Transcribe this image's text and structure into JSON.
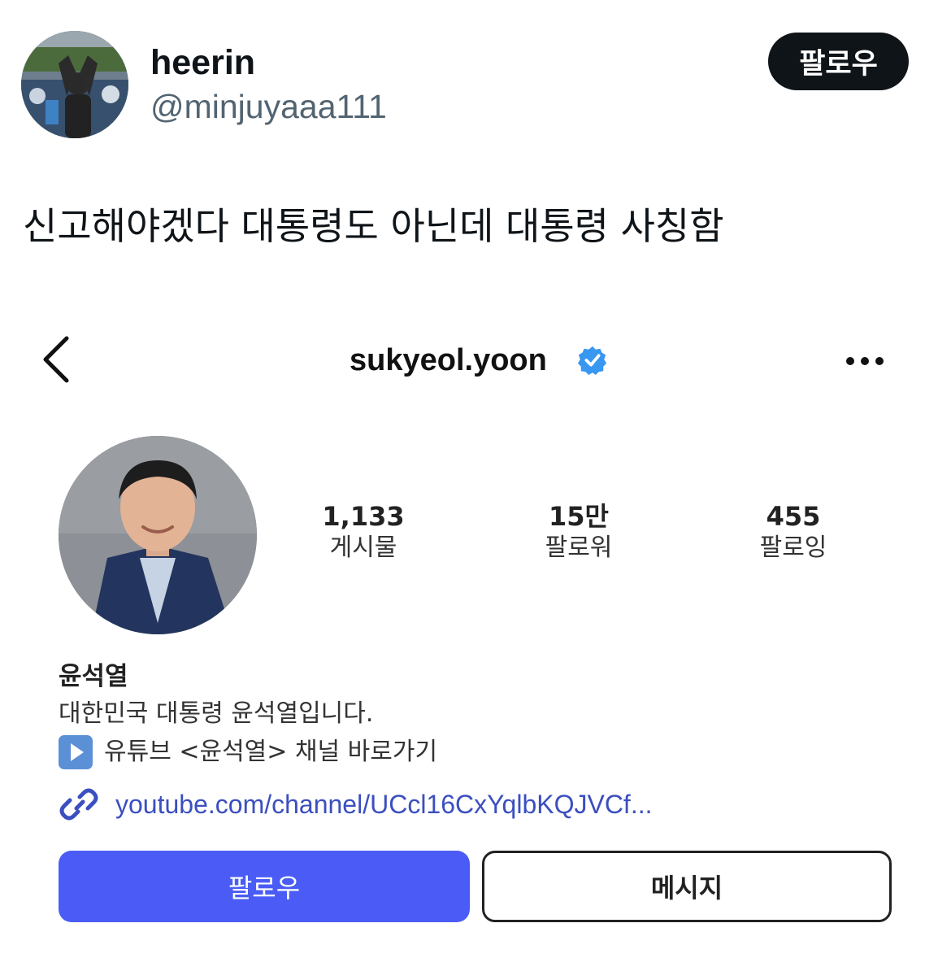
{
  "tweet": {
    "author_name": "heerin",
    "author_handle": "@minjuyaaa111",
    "follow_label": "팔로우",
    "text": "신고해야겠다 대통령도 아닌데 대통령 사칭함"
  },
  "instagram": {
    "username": "sukyeol.yoon",
    "stats": [
      {
        "value": "1,133",
        "label": "게시물"
      },
      {
        "value": "15만",
        "label": "팔로워"
      },
      {
        "value": "455",
        "label": "팔로잉"
      }
    ],
    "bio": {
      "name": "윤석열",
      "line1": "대한민국 대통령 윤석열입니다.",
      "line2": "유튜브 <윤석열> 채널 바로가기",
      "link": "youtube.com/channel/UCcl16CxYqlbKQJVCf..."
    },
    "follow_label": "팔로우",
    "message_label": "메시지",
    "colors": {
      "follow_button": "#4a5cf5",
      "verified_badge": "#3897f0",
      "link": "#3b4fbf"
    }
  }
}
